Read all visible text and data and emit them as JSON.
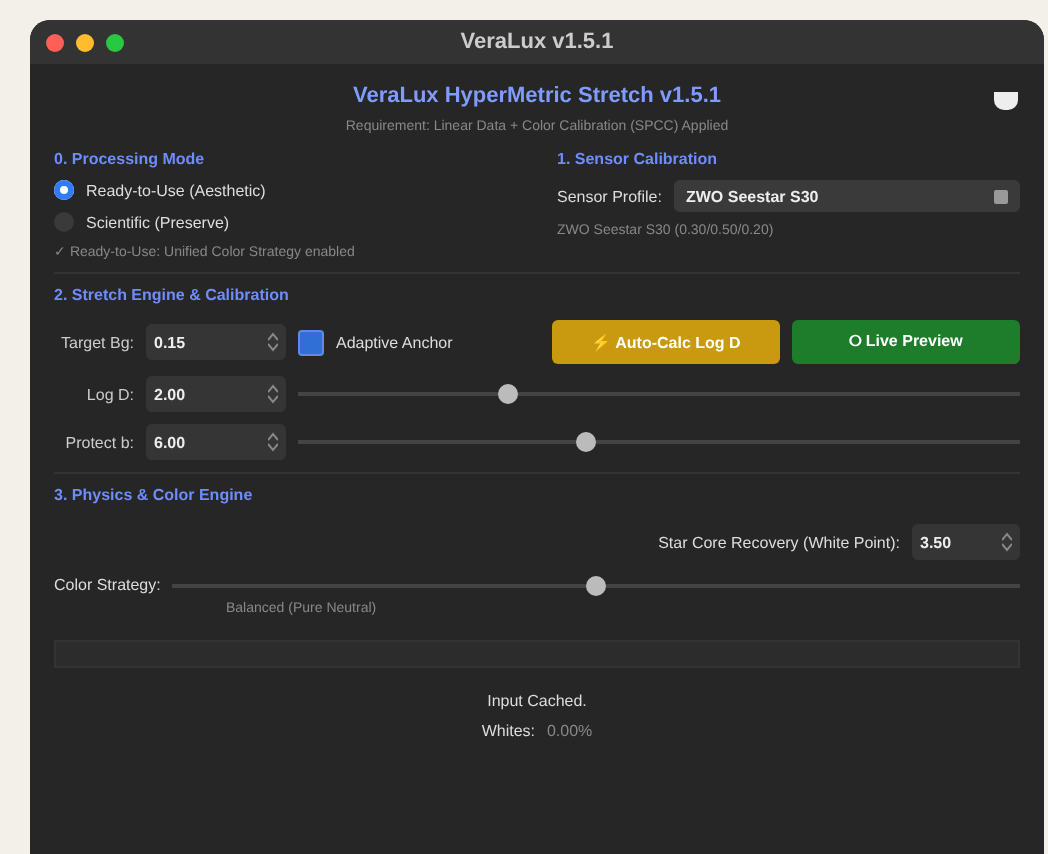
{
  "window": {
    "title": "VeraLux v1.5.1"
  },
  "header": {
    "title": "VeraLux HyperMetric Stretch v1.5.1",
    "subtitle": "Requirement: Linear Data + Color Calibration (SPCC) Applied"
  },
  "processing_mode": {
    "title": "0. Processing Mode",
    "options": [
      {
        "label": "Ready-to-Use (Aesthetic)",
        "selected": true
      },
      {
        "label": "Scientific (Preserve)",
        "selected": false
      }
    ],
    "note": "✓ Ready-to-Use: Unified Color Strategy enabled"
  },
  "sensor": {
    "title": "1. Sensor Calibration",
    "label": "Sensor Profile:",
    "value": "ZWO Seestar S30",
    "note": "ZWO Seestar S30 (0.30/0.50/0.20)"
  },
  "stretch": {
    "title": "2. Stretch Engine & Calibration",
    "target": {
      "label": "Target Bg:",
      "value": "0.15"
    },
    "adaptive": {
      "label": "Adaptive Anchor",
      "checked": true
    },
    "buttons": [
      {
        "kind": "auto",
        "icon": "⚡",
        "label": "Auto-Calc Log D"
      },
      {
        "kind": "preview",
        "icon": "⭘",
        "label": "Live Preview"
      }
    ],
    "sliders": [
      {
        "label": "Log D:",
        "value": "2.00",
        "level": 0.29
      },
      {
        "label": "Protect b:",
        "value": "6.00",
        "level": 0.4
      }
    ]
  },
  "physics": {
    "title": "3. Physics & Color Engine",
    "star_core": {
      "label": "Star Core Recovery (White Point):",
      "value": "3.50"
    },
    "color_strategy": {
      "label": "Color Strategy:",
      "level": 0.5,
      "caption": "Balanced (Pure Neutral)"
    }
  },
  "progress": {
    "level": 0
  },
  "status": {
    "lines": [
      {
        "label": "Input Cached."
      },
      {
        "label": "Whites:",
        "value": "0.00%"
      }
    ]
  }
}
